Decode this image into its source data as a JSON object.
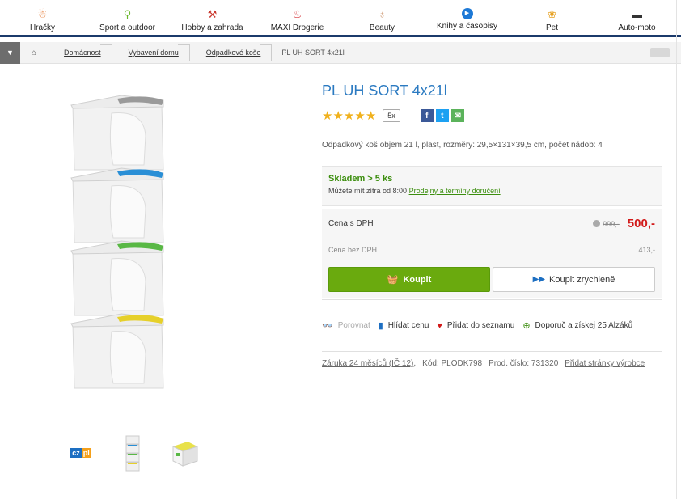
{
  "nav": {
    "categories": [
      {
        "label": "Hračky",
        "icon": "toy-icon",
        "color": "#e4742b"
      },
      {
        "label": "Sport a outdoor",
        "icon": "bicycle-icon",
        "color": "#6ab82c"
      },
      {
        "label": "Hobby a zahrada",
        "icon": "drill-icon",
        "color": "#c9382e"
      },
      {
        "label": "MAXI Drogerie",
        "icon": "spray-icon",
        "color": "#d6353b"
      },
      {
        "label": "Beauty",
        "icon": "perfume-icon",
        "color": "#c68a5e"
      },
      {
        "label": "Knihy a časopisy",
        "icon": "play-icon",
        "color": "#1d79d6"
      },
      {
        "label": "Pet",
        "icon": "paw-icon",
        "color": "#e6a020"
      },
      {
        "label": "Auto-moto",
        "icon": "car-icon",
        "color": "#333333"
      }
    ]
  },
  "breadcrumb": {
    "items": [
      "Domácnost",
      "Vybavení domu",
      "Odpadkové koše"
    ],
    "current": "PL UH SORT 4x21l"
  },
  "product": {
    "title": "PL UH SORT 4x21l",
    "rating": {
      "stars": 5,
      "count": "5x"
    },
    "description": "Odpadkový koš objem 21 l, plast, rozměry: 29,5×131×39,5 cm, počet nádob: 4",
    "stock": {
      "status": "Skladem > 5 ks",
      "note": "Můžete mít zítra od 8:00",
      "link": "Prodejny a termíny doručení"
    },
    "price": {
      "label": "Cena s DPH",
      "old": "999,-",
      "current": "500,-",
      "without_vat_label": "Cena bez DPH",
      "without_vat": "413,-"
    },
    "buttons": {
      "buy": "Koupit",
      "buy_fast": "Koupit zrychleně"
    },
    "actions": {
      "compare": "Porovnat",
      "watch": "Hlídat cenu",
      "wishlist": "Přidat do seznamu",
      "recommend": "Doporuč a získej 25 Alzáků"
    },
    "meta": {
      "warranty": "Záruka 24 měsíců (IČ 12)",
      "code": "Kód: PLODK798",
      "prod_no": "Prod. číslo: 731320",
      "add_page": "Přidat stránky výrobce"
    },
    "gallery": {
      "badge_cz": "cz",
      "badge_pl": "pl"
    },
    "lid_colors": [
      "#9a9a9a",
      "#2a8fd6",
      "#59b845",
      "#e6d02a"
    ]
  }
}
